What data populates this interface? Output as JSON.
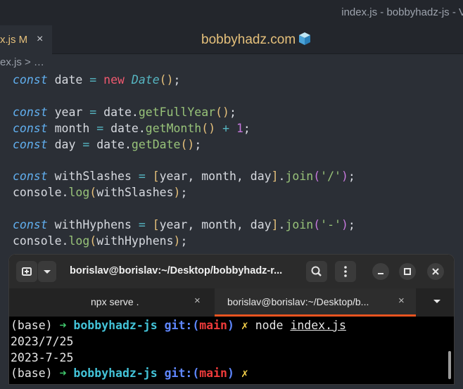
{
  "window": {
    "title": "index.js - bobbyhadz-js - V"
  },
  "editor_tab": {
    "name": "x.js M",
    "close": "×"
  },
  "brand": "bobbyhadz.com",
  "breadcrumb": "ex.js > …",
  "code": {
    "l1": {
      "kw": "const",
      "a": " date ",
      "op": "=",
      "b": " ",
      "new": "new",
      "c": " ",
      "cls": "Date",
      "p1": "(",
      "p2": ")",
      "end": ";"
    },
    "l2": {
      "kw": "const",
      "a": " year ",
      "op": "=",
      "b": " date.",
      "fn": "getFullYear",
      "p1": "(",
      "p2": ")",
      "end": ";"
    },
    "l3": {
      "kw": "const",
      "a": " month ",
      "op": "=",
      "b": " date.",
      "fn": "getMonth",
      "p1": "(",
      "p2": ")",
      "c": " ",
      "op2": "+",
      "d": " ",
      "num": "1",
      "end": ";"
    },
    "l4": {
      "kw": "const",
      "a": " day ",
      "op": "=",
      "b": " date.",
      "fn": "getDate",
      "p1": "(",
      "p2": ")",
      "end": ";"
    },
    "l5": {
      "kw": "const",
      "a": " withSlashes ",
      "op": "=",
      "b": " ",
      "br1": "[",
      "vars": "year, month, day",
      "br2": "]",
      "dot": ".",
      "fn": "join",
      "p1": "(",
      "str": "'/'",
      "p2": ")",
      "end": ";"
    },
    "l6": {
      "obj": "console.",
      "fn": "log",
      "p1": "(",
      "arg": "withSlashes",
      "p2": ")",
      "end": ";"
    },
    "l7": {
      "kw": "const",
      "a": " withHyphens ",
      "op": "=",
      "b": " ",
      "br1": "[",
      "vars": "year, month, day",
      "br2": "]",
      "dot": ".",
      "fn": "join",
      "p1": "(",
      "str": "'-'",
      "p2": ")",
      "end": ";"
    },
    "l8": {
      "obj": "console.",
      "fn": "log",
      "p1": "(",
      "arg": "withHyphens",
      "p2": ")",
      "end": ";"
    }
  },
  "terminal": {
    "title": "borislav@borislav:~/Desktop/bobbyhadz-r...",
    "tabs": [
      {
        "label": "npx serve .",
        "close": "×"
      },
      {
        "label": "borislav@borislav:~/Desktop/b...",
        "close": "×"
      }
    ],
    "prompt": {
      "env": "(base) ",
      "arrow": "➜",
      "dir": "bobbyhadz-js",
      "git": "git:(",
      "branch": "main",
      "git_end": ")",
      "dirty": "✗"
    },
    "command": {
      "cmd": "node",
      "arg": "index.js"
    },
    "output": [
      "2023/7/25",
      "2023-7-25"
    ]
  }
}
